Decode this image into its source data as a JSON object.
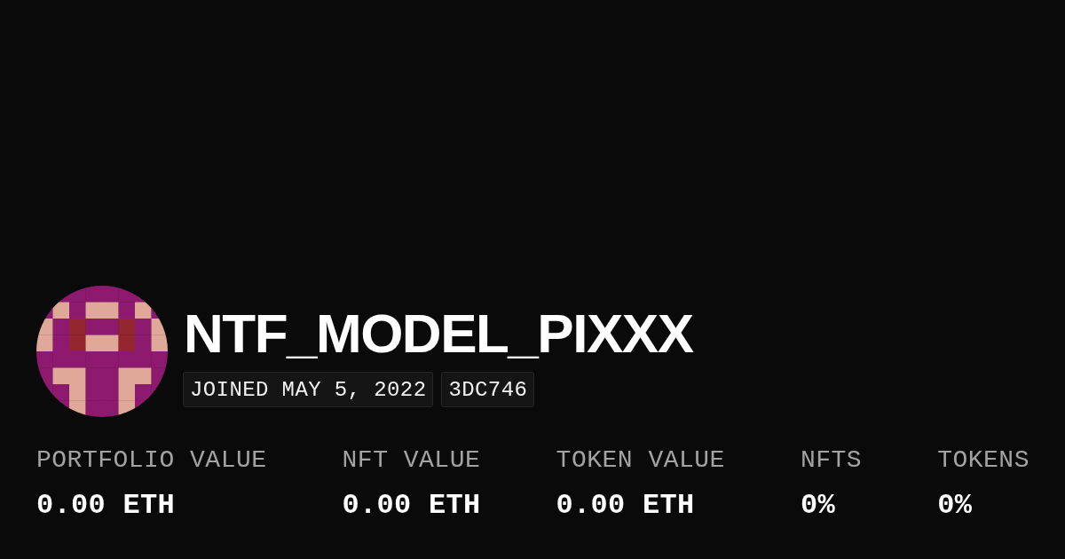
{
  "profile": {
    "name": "NTF_MODEL_PIXXX",
    "badges": [
      "JOINED MAY 5, 2022",
      "3DC746"
    ]
  },
  "stats": [
    {
      "label": "PORTFOLIO VALUE",
      "value": "0.00 ETH"
    },
    {
      "label": "NFT VALUE",
      "value": "0.00 ETH"
    },
    {
      "label": "TOKEN VALUE",
      "value": "0.00 ETH"
    },
    {
      "label": "NFTS",
      "value": "0%"
    },
    {
      "label": "TOKENS",
      "value": "0%"
    }
  ]
}
